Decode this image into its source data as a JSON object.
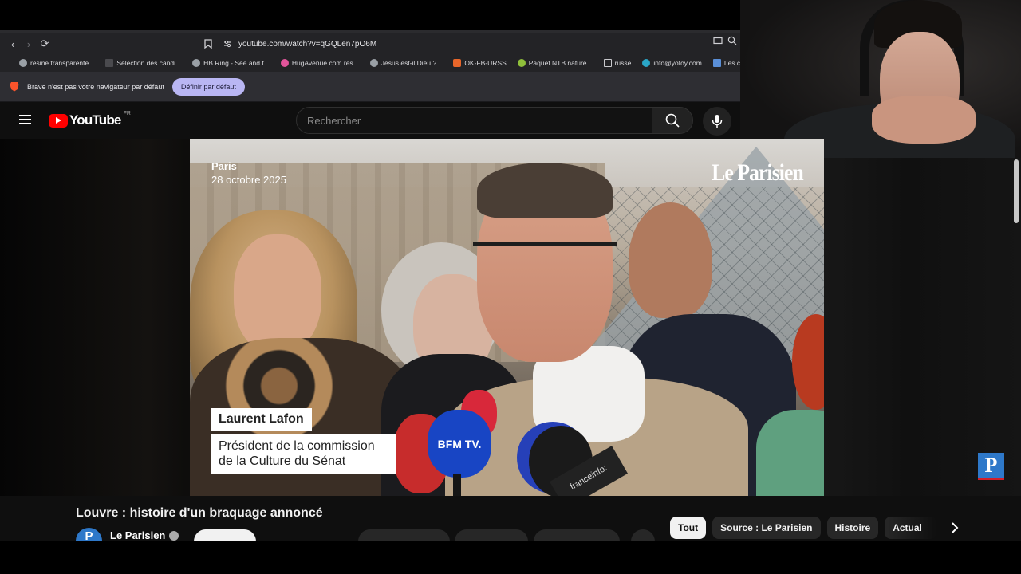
{
  "browser": {
    "url": "youtube.com/watch?v=qGQLen7pO6M",
    "bookmarks": [
      {
        "label": "résine transparente...",
        "color": "#9aa0a6"
      },
      {
        "label": "Sélection des candi...",
        "color": "#2b2b2e"
      },
      {
        "label": "HB Ring - See and f...",
        "color": "#9aa0a6"
      },
      {
        "label": "HugAvenue.com res...",
        "color": "#e2559b"
      },
      {
        "label": "Jésus est-il Dieu ?...",
        "color": "#9aa0a6"
      },
      {
        "label": "OK-FB-URSS",
        "color": "#e8662a"
      },
      {
        "label": "Paquet NTB nature...",
        "color": "#8fbf3a"
      },
      {
        "label": "russe",
        "color": "#c9c9cd"
      },
      {
        "label": "info@yotoy.com",
        "color": "#2aa6c7"
      },
      {
        "label": "Les concours d'a",
        "color": "#5a8fd8"
      }
    ],
    "infobar": {
      "message": "Brave n'est pas votre navigateur par défaut",
      "button": "Définir par défaut"
    }
  },
  "youtube": {
    "logo_text": "YouTube",
    "country": "FR",
    "search_placeholder": "Rechercher"
  },
  "video": {
    "location_city": "Paris",
    "location_date": "28 octobre 2025",
    "brand_overlay": "Le Parisien",
    "lower_third_name": "Laurent Lafon",
    "lower_third_role_line1": "Président de la commission",
    "lower_third_role_line2": "de la Culture du Sénat",
    "mic_bfm": "BFM TV.",
    "mic_franceinfo": "franceinfo:"
  },
  "watch": {
    "title": "Louvre : histoire d'un braquage annoncé",
    "channel_initial": "P",
    "channel_name": "Le Parisien",
    "chips": [
      {
        "label": "Tout",
        "active": true
      },
      {
        "label": "Source : Le Parisien",
        "active": false
      },
      {
        "label": "Histoire",
        "active": false
      },
      {
        "label": "Actual",
        "active": false
      }
    ]
  },
  "side_badge": "P",
  "colors": {
    "youtube_red": "#ff0000",
    "brave_button": "#b9b6f3",
    "leparisien_blue": "#2e78c9"
  }
}
